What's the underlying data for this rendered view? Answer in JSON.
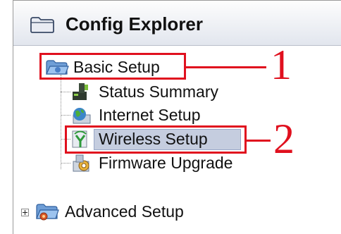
{
  "panel": {
    "title": "Config Explorer",
    "title_icon": "folder-icon"
  },
  "tree": {
    "basic_setup": {
      "label": "Basic Setup",
      "icon": "open-folder-icon"
    },
    "children": [
      {
        "label": "Status Summary",
        "icon": "status-monitor-icon"
      },
      {
        "label": "Internet Setup",
        "icon": "globe-icon"
      },
      {
        "label": "Wireless Setup",
        "icon": "wireless-antenna-icon"
      },
      {
        "label": "Firmware Upgrade",
        "icon": "firmware-chip-icon"
      }
    ],
    "advanced_setup": {
      "label": "Advanced Setup",
      "icon": "folder-gear-icon"
    }
  },
  "annotations": {
    "callout_1": "1",
    "callout_2": "2",
    "color": "#e0101e"
  }
}
